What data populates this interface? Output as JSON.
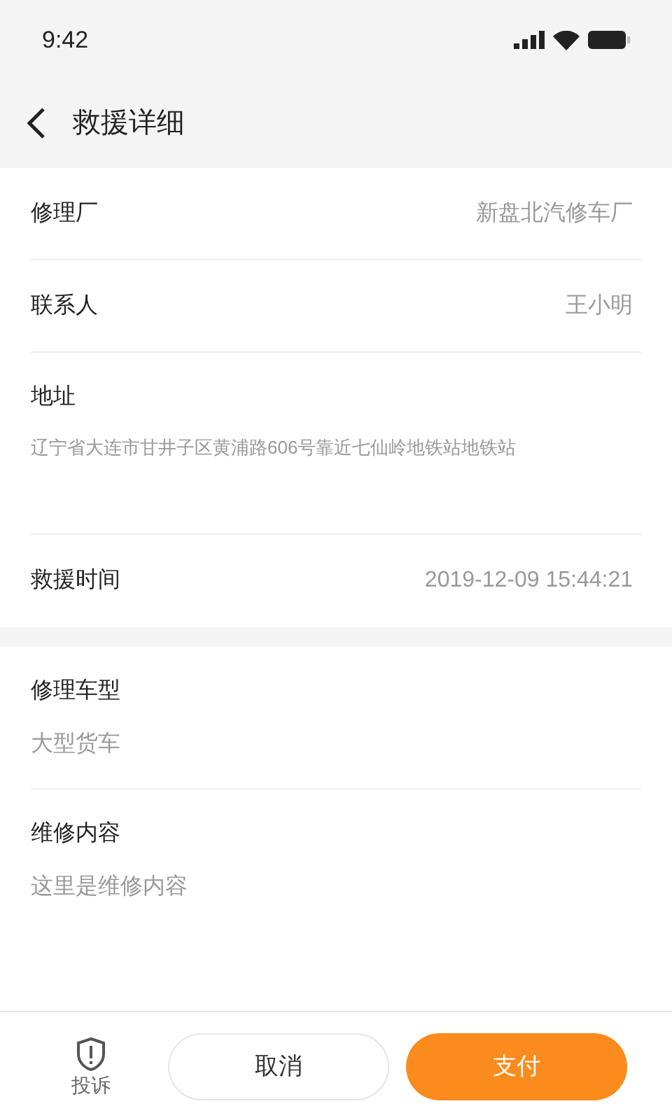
{
  "status_bar": {
    "time": "9:42"
  },
  "header": {
    "title": "救援详细"
  },
  "sections": [
    {
      "rows": [
        {
          "kind": "inline",
          "label": "修理厂",
          "value": "新盘北汽修车厂"
        },
        {
          "kind": "inline",
          "label": "联系人",
          "value": "王小明"
        },
        {
          "kind": "stacked",
          "label": "地址",
          "value": "辽宁省大连市甘井子区黄浦路606号靠近七仙岭地铁站地铁站",
          "tall": true
        },
        {
          "kind": "inline",
          "label": "救援时间",
          "value": "2019-12-09 15:44:21"
        }
      ]
    },
    {
      "rows": [
        {
          "kind": "stacked",
          "label": "修理车型",
          "value": "大型货车",
          "tall": false
        },
        {
          "kind": "stacked",
          "label": "维修内容",
          "value": "这里是维修内容",
          "tall": true
        }
      ]
    }
  ],
  "bottom_bar": {
    "complain": "投诉",
    "cancel": "取消",
    "pay": "支付"
  }
}
